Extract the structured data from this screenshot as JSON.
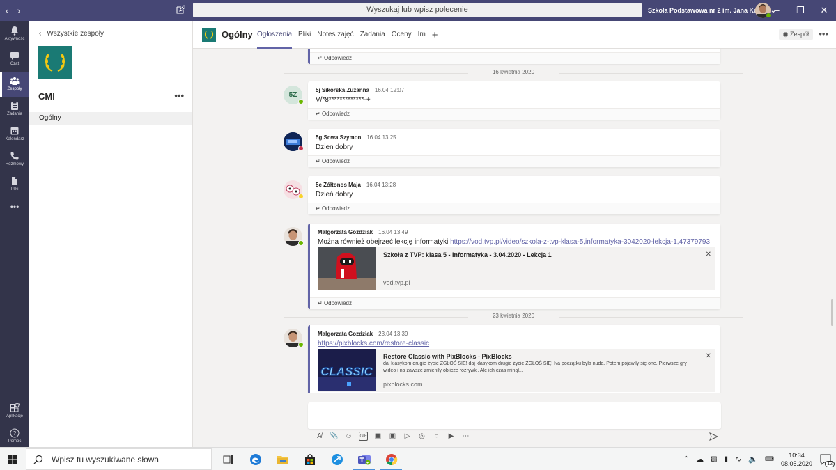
{
  "titlebar": {
    "back_icon": "chevron-left-icon",
    "forward_icon": "chevron-right-icon",
    "search_placeholder": "Wyszukaj lub wpisz polecenie",
    "org_name": "Szkoła Podstawowa nr 2 im. Jana Koc...",
    "accent_color": "#464775"
  },
  "rail": {
    "items": [
      {
        "label": "Aktywność",
        "icon": "bell-icon"
      },
      {
        "label": "Czat",
        "icon": "chat-icon"
      },
      {
        "label": "Zespoły",
        "icon": "teams-icon"
      },
      {
        "label": "Zadania",
        "icon": "assignments-icon"
      },
      {
        "label": "Kalendarz",
        "icon": "calendar-icon"
      },
      {
        "label": "Rozmowy",
        "icon": "phone-icon"
      },
      {
        "label": "Pliki",
        "icon": "files-icon"
      },
      {
        "label": "Aplikacje",
        "icon": "apps-icon"
      },
      {
        "label": "Pomoc",
        "icon": "help-icon"
      }
    ],
    "more": "•••"
  },
  "panel": {
    "back_label": "Wszystkie zespoły",
    "team_name": "CMI",
    "more": "•••",
    "channel": "Ogólny"
  },
  "channel": {
    "title": "Ogólny",
    "tabs": [
      "Ogłoszenia",
      "Pliki",
      "Notes zajęć",
      "Zadania",
      "Oceny",
      "Im"
    ],
    "team_button": "Zespół",
    "more": "•••"
  },
  "conversation": {
    "reply_label": "Odpowiedz",
    "dates": [
      "16 kwietnia 2020",
      "23 kwietnia 2020"
    ],
    "messages": [
      {
        "author": "5j Sikorska Zuzanna",
        "time": "16.04 12:07",
        "text": "V/*8*************-+",
        "initials": "5Z"
      },
      {
        "author": "5g Sowa Szymon",
        "time": "16.04 13:25",
        "text": "Dzien dobry"
      },
      {
        "author": "5e Żółtonos Maja",
        "time": "16.04 13:28",
        "text": "Dzień dobry"
      },
      {
        "author": "Malgorzata Gozdziak",
        "time": "16.04 13:49",
        "text": "Można również obejrzeć lekcję informatyki ",
        "link": "https://vod.tvp.pl/video/szkola-z-tvp-klasa-5,informatyka-3042020-lekcja-1,47379793",
        "preview": {
          "title": "Szkoła z TVP: klasa 5 - Informatyka - 3.04.2020 - Lekcja 1",
          "domain": "vod.tvp.pl",
          "close": "✕"
        }
      },
      {
        "author": "Malgorzata Gozdziak",
        "time": "23.04 13:39",
        "link": "https://pixblocks.com/restore-classic",
        "preview": {
          "title": "Restore Classic with PixBlocks - PixBlocks",
          "desc": "daj klasykom drugie życie ZGŁOŚ SIĘ! daj klasykom drugie życie ZGŁOŚ SIĘ! Na początku była nuda. Potem pojawiły się one. Pierwsze gry wideo i na zawsze zmieniły oblicze rozrywki. Ale ich czas minął...",
          "domain": "pixblocks.com",
          "close": "✕",
          "thumb_text": "CLASSIC"
        }
      }
    ]
  },
  "taskbar": {
    "search_placeholder": "Wpisz tu wyszukiwane słowa",
    "time": "10:34",
    "date": "08.05.2020",
    "notifications": "12"
  }
}
